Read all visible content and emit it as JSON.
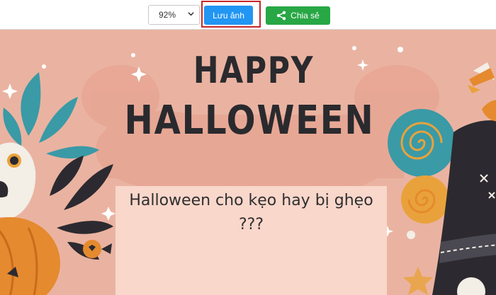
{
  "toolbar": {
    "zoom_value": "92%",
    "save_label": "Lưu ảnh",
    "share_label": "Chia sẻ"
  },
  "card": {
    "title_line1": "HAPPY",
    "title_line2": "HALLOWEEN",
    "message": "Halloween cho kẹo hay bị ghẹo ???"
  },
  "colors": {
    "card_background": "#eab3a1",
    "save_button": "#2196f3",
    "share_button": "#28a745",
    "highlight": "#c62828"
  }
}
